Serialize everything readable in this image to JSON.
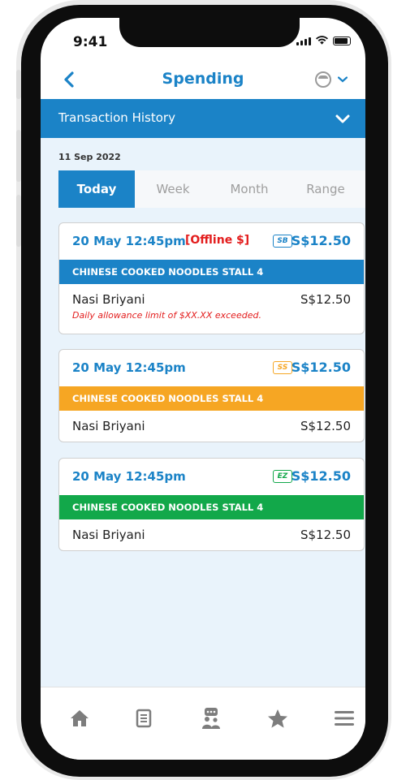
{
  "status_bar": {
    "time": "9:41"
  },
  "header": {
    "title": "Spending"
  },
  "transaction_history": {
    "label": "Transaction History"
  },
  "filter": {
    "date": "11 Sep 2022",
    "tabs": [
      "Today",
      "Week",
      "Month",
      "Range"
    ],
    "active_tab": "Today"
  },
  "transactions": [
    {
      "datetime": "20 May 12:45pm",
      "offline_label": "[Offline $]",
      "badge": "SB",
      "badge_color": "#1b83c7",
      "amount": "S$12.50",
      "stall": "CHINESE COOKED NOODLES STALL 4",
      "stall_color": "#1b83c7",
      "item_name": "Nasi Briyani",
      "item_price": "S$12.50",
      "warning": "Daily allowance limit of $XX.XX exceeded."
    },
    {
      "datetime": "20 May 12:45pm",
      "badge": "SS",
      "badge_color": "#f6a623",
      "amount": "S$12.50",
      "stall": "CHINESE COOKED NOODLES STALL 4",
      "stall_color": "#f6a623",
      "item_name": "Nasi Briyani",
      "item_price": "S$12.50"
    },
    {
      "datetime": "20 May 12:45pm",
      "badge": "EZ",
      "badge_color": "#12a84a",
      "amount": "S$12.50",
      "stall": "CHINESE COOKED NOODLES STALL 4",
      "stall_color": "#12a84a",
      "item_name": "Nasi Briyani",
      "item_price": "S$12.50"
    }
  ],
  "bottom_nav": {
    "icons": [
      "home-icon",
      "receipt-icon",
      "chat-support-icon",
      "star-icon",
      "menu-icon"
    ]
  },
  "colors": {
    "primary": "#1b83c7",
    "content_bg": "#e9f3fb",
    "error": "#e31d1d",
    "nav_icon": "#7d7d7d"
  }
}
